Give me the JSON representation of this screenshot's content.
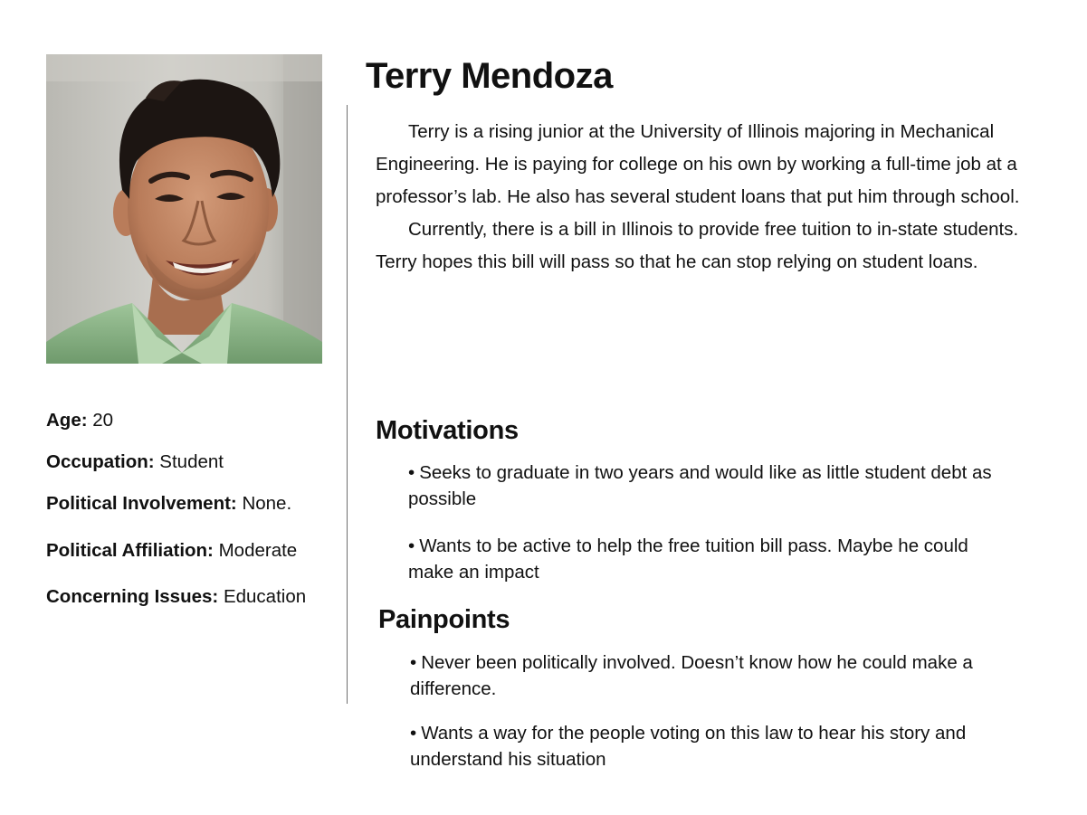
{
  "persona": {
    "name": "Terry Mendoza",
    "bio": [
      "Terry is a rising junior at the University of Illinois majoring in Mechanical Engineering. He is paying for college on his own by working a full-time job at a professor’s lab. He also has several student loans that put him through school.",
      "Currently, there is a bill in Illinois to provide free tuition to in-state students. Terry hopes this bill will pass so that he can stop relying on student loans."
    ],
    "facts": [
      {
        "label": "Age:",
        "value": "20"
      },
      {
        "label": "Occupation:",
        "value": "Student"
      },
      {
        "label": "Political Involvement:",
        "value": "None."
      },
      {
        "label": "Political Affiliation:",
        "value": "Moderate"
      },
      {
        "label": "Concerning Issues:",
        "value": "Education"
      }
    ],
    "motivations": {
      "title": "Motivations",
      "items": [
        "Seeks to graduate in two years and would like as little student debt as possible",
        "Wants to be active to help the free tuition bill pass.  Maybe he could make an impact"
      ]
    },
    "painpoints": {
      "title": "Painpoints",
      "items": [
        "Never been politically involved. Doesn’t know how he could make a difference.",
        "Wants a way for the people voting on this law to hear his story and understand his situation"
      ]
    }
  },
  "bullet_glyph": "•"
}
